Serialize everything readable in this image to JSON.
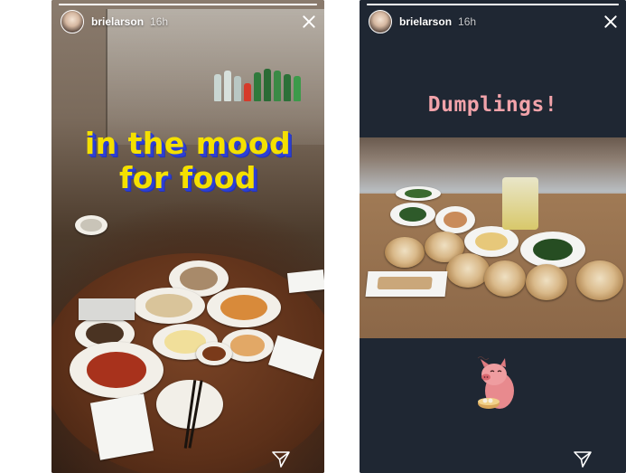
{
  "stories": [
    {
      "user": {
        "username": "brielarson",
        "time_ago": "16h"
      },
      "progress": 1.0,
      "sticker_text": {
        "line1": "in the mood",
        "line2": "for food"
      }
    },
    {
      "user": {
        "username": "brielarson",
        "time_ago": "16h"
      },
      "progress": 1.0,
      "caption": "Dumplings!"
    }
  ],
  "colors": {
    "sticker_yellow": "#f4e000",
    "sticker_shadow": "#2c3fd6",
    "caption_pink": "#f2a3aa",
    "right_background": "#1f2733"
  },
  "icons": {
    "close": "close-icon",
    "send": "paper-plane-icon",
    "sticker": "pig-sticker"
  }
}
